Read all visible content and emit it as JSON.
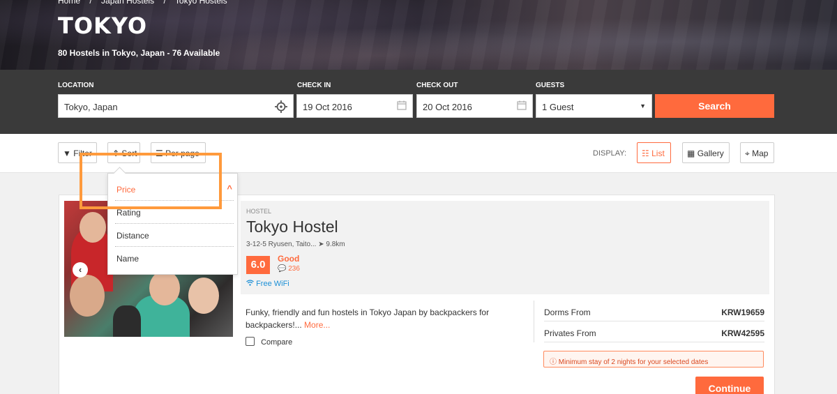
{
  "hero": {
    "breadcrumb": [
      "Home",
      "/",
      "Japan Hostels",
      "/",
      "Tokyo Hostels"
    ],
    "title": "TOKYO",
    "subtitle": "80 Hostels in Tokyo, Japan - 76 Available"
  },
  "search": {
    "location_label": "LOCATION",
    "location_value": "Tokyo, Japan",
    "checkin_label": "CHECK IN",
    "checkin_value": "19 Oct 2016",
    "checkout_label": "CHECK OUT",
    "checkout_value": "20 Oct 2016",
    "guests_label": "GUESTS",
    "guests_value": "1 Guest",
    "search_button": "Search"
  },
  "toolbar": {
    "filter_label": "Filter",
    "sort_label": "Sort",
    "perpage_label": "Per page",
    "display_label": "DISPLAY:",
    "list_label": "List",
    "gallery_label": "Gallery",
    "map_label": "Map"
  },
  "sort_menu": {
    "options": [
      "Price",
      "Rating",
      "Distance",
      "Name"
    ]
  },
  "listing": {
    "type": "HOSTEL",
    "name": "Tokyo Hostel",
    "address": "3-12-5 Ryusen, Taito...",
    "distance": "9.8km",
    "score": "6.0",
    "rating_word": "Good",
    "reviews": "236",
    "amenity": "Free WiFi",
    "description": "Funky, friendly and fun hostels in Tokyo Japan by backpackers for backpackers!...",
    "more_link": "More...",
    "compare_label": "Compare",
    "dorms_label": "Dorms From",
    "dorms_price": "KRW19659",
    "privates_label": "Privates From",
    "privates_price": "KRW42595",
    "min_stay": "Minimum stay of 2 nights for your selected dates",
    "continue_button": "Continue"
  },
  "colors": {
    "accent": "#ff6a3d",
    "highlight": "#ff9a3c",
    "wifi": "#1b8fd6"
  }
}
